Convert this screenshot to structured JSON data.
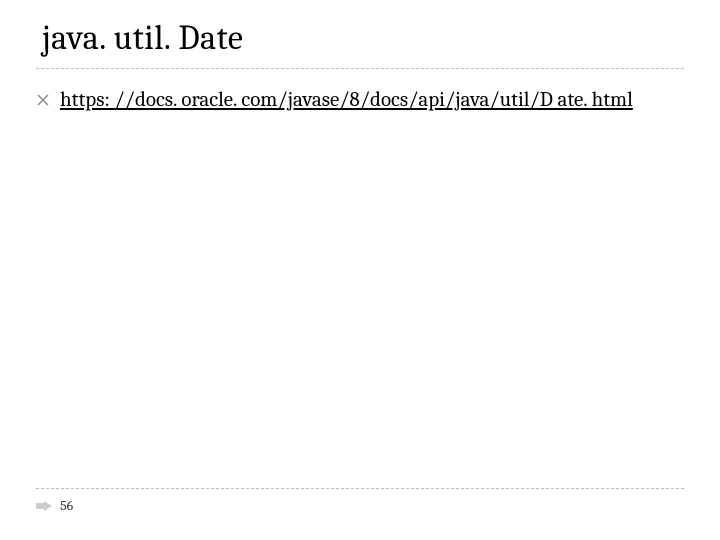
{
  "title": "java. util. Date",
  "bullets": [
    {
      "link_text": "https: //docs. oracle. com/javase/8/docs/api/java/util/D ate. html"
    }
  ],
  "page_number": "56"
}
